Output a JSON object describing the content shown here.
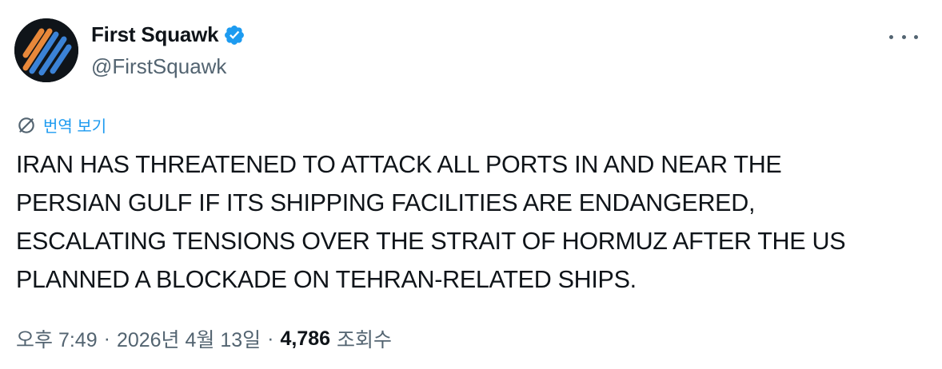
{
  "author": {
    "display_name": "First Squawk",
    "handle": "@FirstSquawk",
    "verified": true,
    "avatar_icon": "first-squawk-logo",
    "verified_icon": "verified-badge-icon"
  },
  "actions": {
    "more_icon": "more-options-icon"
  },
  "translate": {
    "label": "번역 보기",
    "icon": "globe-translate-icon"
  },
  "tweet": {
    "lines": [
      "IRAN HAS THREATENED TO ATTACK ALL PORTS IN AND NEAR THE",
      "PERSIAN GULF IF ITS SHIPPING FACILITIES ARE ENDANGERED,",
      "ESCALATING TENSIONS OVER THE STRAIT OF HORMUZ AFTER THE US",
      "PLANNED A BLOCKADE ON TEHRAN-RELATED SHIPS."
    ]
  },
  "meta": {
    "time": "오후 7:49",
    "separator": "·",
    "date": "2026년 4월 13일",
    "views_count": "4,786",
    "views_label": "조회수"
  },
  "colors": {
    "accent": "#1d9bf0",
    "secondary_text": "#536471",
    "primary_text": "#0f1419",
    "logo_orange": "#e8883a",
    "logo_blue": "#3b82d6"
  }
}
